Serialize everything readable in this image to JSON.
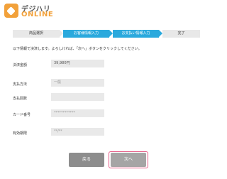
{
  "logo": {
    "line1": "デジハリ",
    "line2": "ONLINE"
  },
  "steps": [
    {
      "label": "商品選択",
      "state": "done"
    },
    {
      "label": "お客様情報入力",
      "state": "done"
    },
    {
      "label": "お支払い情報入力",
      "state": "current"
    },
    {
      "label": "完了",
      "state": "todo"
    }
  ],
  "instructions": "以下情報で決済します。よろしければ、「次へ」ボタンをクリックしてください。",
  "form": {
    "amount_label": "決済金額",
    "amount_value": "39,980円",
    "method_label": "支払方法",
    "method_value": "一般",
    "count_label": "支払回数",
    "count_value": "",
    "card_label": "カード番号",
    "card_value": "************",
    "expiry_label": "有効期限",
    "expiry_value": "**/**"
  },
  "buttons": {
    "back_label": "戻る",
    "next_label": "次へ"
  },
  "colors": {
    "accent": "#2aa9dd",
    "brand": "#f2a13a",
    "highlight": "#e45a85"
  }
}
